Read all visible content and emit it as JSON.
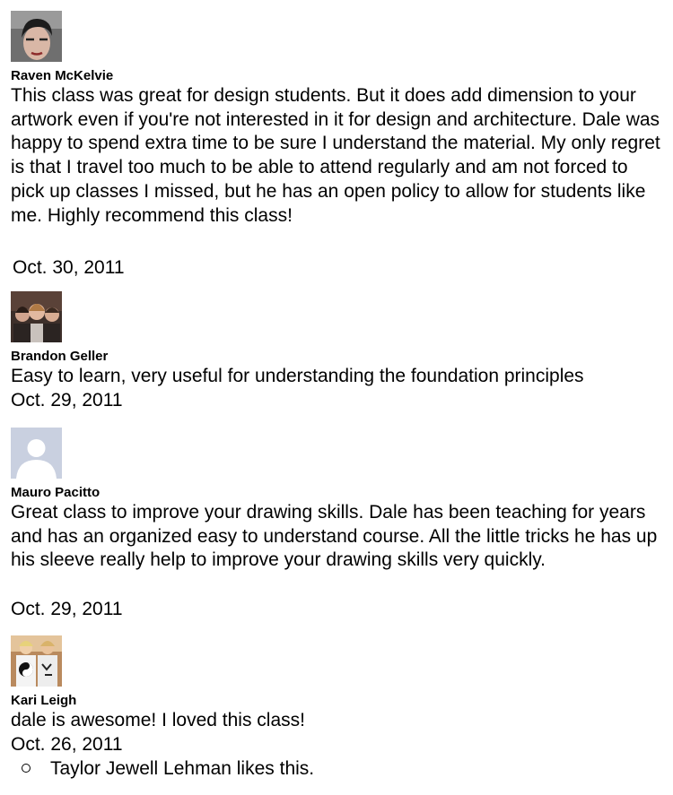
{
  "reviews": [
    {
      "name": "Raven McKelvie",
      "avatar": "profile-photo-woman",
      "text": "This class was great for design students. But it does add dimension to your artwork even if you're not interested in it for design and architecture. Dale was happy to spend extra time to be sure I understand the material. My only regret is that I travel too much to be able to attend regularly and am not forced to pick up classes I missed, but he has an open policy to allow for students like me. Highly recommend this class!",
      "date": "Oct. 30, 2011"
    },
    {
      "name": "Brandon Geller",
      "avatar": "profile-photo-group",
      "text": "Easy to learn, very useful for understanding the foundation principles",
      "date": "Oct. 29, 2011"
    },
    {
      "name": "Mauro Pacitto",
      "avatar": "default-silhouette",
      "text": "Great class to improve your drawing skills. Dale has been teaching for years and has an organized easy to understand course. All the little tricks he has up his sleeve really help to improve your drawing skills very quickly.",
      "date": "Oct. 29, 2011"
    },
    {
      "name": "Kari Leigh",
      "avatar": "profile-photo-yin-yang",
      "text": "dale is awesome! I loved this class!",
      "date": "Oct. 26, 2011",
      "likes": "Taylor Jewell Lehman likes this."
    }
  ],
  "colors": {
    "text": "#000000",
    "background": "#ffffff",
    "silhouette_bg": "#c9d0e0",
    "silhouette_fg": "#ffffff"
  }
}
